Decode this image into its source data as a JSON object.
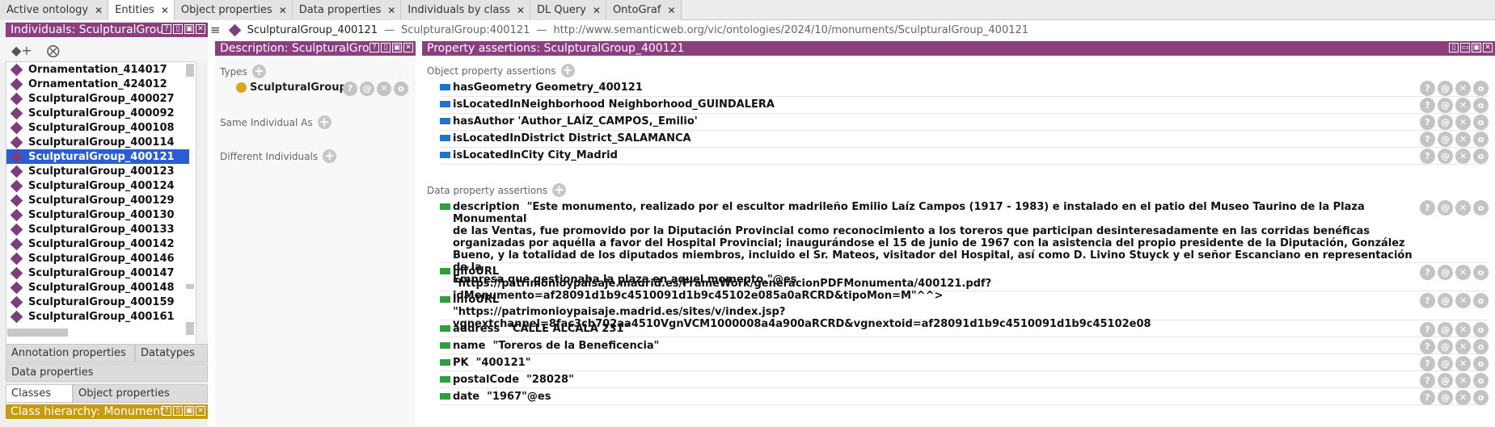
{
  "tabs": [
    {
      "label": "Active ontology",
      "active": false
    },
    {
      "label": "Entities",
      "active": true
    },
    {
      "label": "Object properties",
      "active": false
    },
    {
      "label": "Data properties",
      "active": false
    },
    {
      "label": "Individuals by class",
      "active": false
    },
    {
      "label": "DL Query",
      "active": false
    },
    {
      "label": "OntoGraf",
      "active": false
    }
  ],
  "left": {
    "individuals_title": "Individuals: SculpturalGroup_400121",
    "toolbar_icons": [
      "add-individual-icon",
      "delete-individual-icon"
    ],
    "individuals": [
      "Ornamentation_414017",
      "Ornamentation_424012",
      "SculpturalGroup_400027",
      "SculpturalGroup_400092",
      "SculpturalGroup_400108",
      "SculpturalGroup_400114",
      "SculpturalGroup_400121",
      "SculpturalGroup_400123",
      "SculpturalGroup_400124",
      "SculpturalGroup_400129",
      "SculpturalGroup_400130",
      "SculpturalGroup_400133",
      "SculpturalGroup_400142",
      "SculpturalGroup_400146",
      "SculpturalGroup_400147",
      "SculpturalGroup_400148",
      "SculpturalGroup_400159",
      "SculpturalGroup_400161"
    ],
    "selected_index": 6,
    "tabs_row1": [
      "Annotation properties",
      "Datatypes"
    ],
    "tabs_row2": [
      "Data properties"
    ],
    "tabs_row3": [
      "Classes",
      "Object properties"
    ],
    "class_hierarchy_title": "Class hierarchy: Monument"
  },
  "crumb": {
    "name": "SculpturalGroup_400121",
    "sep1": "—",
    "prefixed": "SculpturalGroup:400121",
    "sep2": "—",
    "iri": "http://www.semanticweb.org/vic/ontologies/2024/10/monuments/SculpturalGroup_400121"
  },
  "description": {
    "title": "Description: SculpturalGroup_400121",
    "types_label": "Types",
    "type_value": "SculpturalGroup",
    "same_label": "Same Individual As",
    "different_label": "Different Individuals"
  },
  "props": {
    "title": "Property assertions: SculpturalGroup_400121",
    "object_label": "Object property assertions",
    "object_assertions": [
      "hasGeometry  Geometry_400121",
      "isLocatedInNeighborhood  Neighborhood_GUINDALERA",
      "hasAuthor  'Author_LAÍZ_CAMPOS,_Emilio'",
      "isLocatedInDistrict  District_SALAMANCA",
      "isLocatedInCity  City_Madrid"
    ],
    "data_label": "Data property assertions",
    "data_assertions": [
      "description  \"Este monumento, realizado por el escultor madrileño Emilio Laíz Campos (1917 - 1983) e instalado en el patio del Museo Taurino de la Plaza Monumental\nde las Ventas, fue promovido por la Diputación Provincial como reconocimiento a los toreros que participan desinteresadamente en las corridas benéficas\norganizadas por aquélla a favor del Hospital Provincial; inaugurándose el 15 de junio de 1967 con la asistencia del propio presidente de la Diputación, González\nBueno, y la totalidad de los diputados miembros, incluido el Sr. Mateos, visitador del Hospital, así como D. Livino Stuyck y el señor Escanciano en representación de la\nEmpresa que gestionaba la plaza en aquel momento.\"@es",
      "infoURL\n\"https://patrimonioypaisaje.madrid.es/FrameWork/generacionPDFMonumenta/400121.pdf?idMonumento=af28091d1b9c4510091d1b9c45102e085a0aRCRD&tipoMon=M\"^^>",
      "infoURL\n\"https://patrimonioypaisaje.madrid.es/sites/v/index.jsp?vgnextchannel=8fac3cb702aa4510VgnVCM1000008a4a900aRCRD&vgnextoid=af28091d1b9c4510091d1b9c45102e08",
      "address  \"CALLE ALCALA 231\"",
      "name  \"Toreros de la Beneficencia\"",
      "PK  \"400121\"",
      "postalCode  \"28028\"",
      "date  \"1967\"@es"
    ]
  },
  "row_icon_labels": [
    "?",
    "@",
    "✕",
    "o"
  ],
  "header_ctrls": [
    "?",
    "⊓",
    "▣",
    "✕"
  ]
}
